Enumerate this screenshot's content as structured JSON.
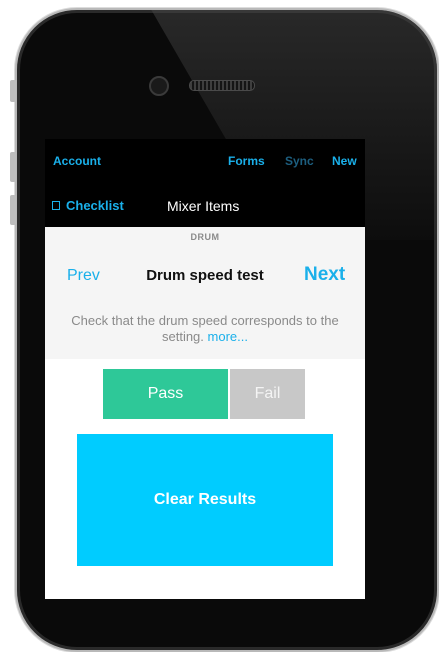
{
  "topbar": {
    "account": "Account",
    "forms": "Forms",
    "sync": "Sync",
    "new": "New"
  },
  "navbar": {
    "back_label": "Checklist",
    "title": "Mixer Items"
  },
  "section": {
    "label": "DRUM"
  },
  "item": {
    "prev": "Prev",
    "title": "Drum speed test",
    "next": "Next",
    "description": "Check that the drum speed corresponds to the setting.",
    "more": "more..."
  },
  "actions": {
    "pass": "Pass",
    "fail": "Fail",
    "clear": "Clear Results"
  },
  "colors": {
    "accent": "#1ab0ea",
    "pass": "#2ec898",
    "fail": "#c8c8c8",
    "clear": "#00ccff"
  }
}
